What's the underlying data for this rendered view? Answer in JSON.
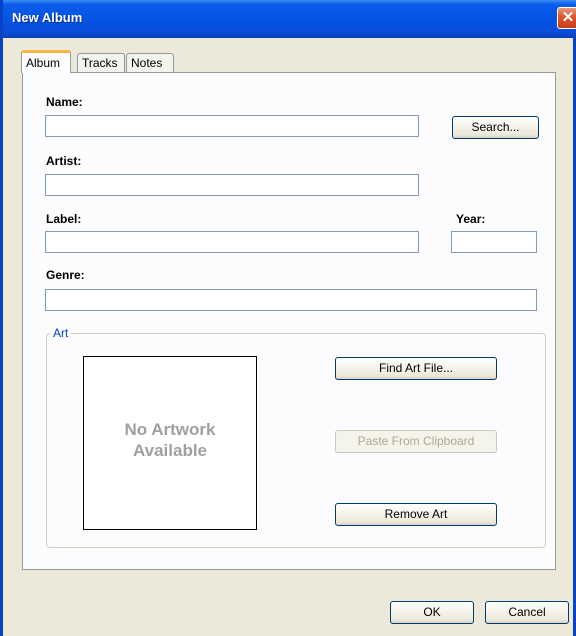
{
  "window": {
    "title": "New Album",
    "close_glyph": "✕"
  },
  "tabs": [
    {
      "label": "Album",
      "active": true
    },
    {
      "label": "Tracks",
      "active": false
    },
    {
      "label": "Notes",
      "active": false
    }
  ],
  "fields": {
    "name": {
      "label": "Name:",
      "value": ""
    },
    "artist": {
      "label": "Artist:",
      "value": ""
    },
    "label": {
      "label": "Label:",
      "value": ""
    },
    "year": {
      "label": "Year:",
      "value": ""
    },
    "genre": {
      "label": "Genre:",
      "value": ""
    }
  },
  "buttons": {
    "search": "Search...",
    "find_art": "Find Art File...",
    "paste": "Paste From Clipboard",
    "remove_art": "Remove Art",
    "ok": "OK",
    "cancel": "Cancel"
  },
  "art": {
    "group_label": "Art",
    "placeholder_line1": "No Artwork",
    "placeholder_line2": "Available"
  },
  "colors": {
    "title_bar": "#0552e3",
    "group_label": "#0046d5",
    "active_tab_accent": "#f7b645"
  }
}
